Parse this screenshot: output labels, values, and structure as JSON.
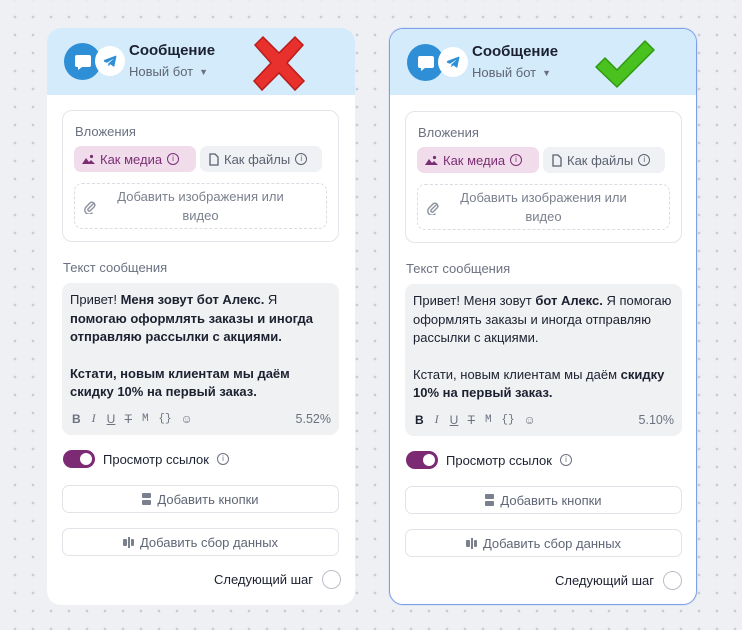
{
  "cards": [
    {
      "id": "left",
      "verdict": "cross",
      "header": {
        "title": "Сообщение",
        "subtitle": "Новый бот"
      },
      "attachments": {
        "label": "Вложения",
        "media_chip": "Как медиа",
        "files_chip": "Как файлы",
        "dropzone": "Добавить изображения или видео"
      },
      "message": {
        "label": "Текст сообщения",
        "segments": [
          {
            "text": "Привет! ",
            "bold": false
          },
          {
            "text": "Меня зовут бот Алекс.",
            "bold": true
          },
          {
            "text": " Я ",
            "bold": false
          },
          {
            "text": "помогаю оформлять заказы и иногда",
            "bold": true
          },
          {
            "text": " отправляю рассылки с акциями.",
            "bold": true,
            "break_after": true
          },
          {
            "text": "Кстати, новым клиентам мы даём скидку 10% на первый заказ.",
            "bold": true
          }
        ],
        "counter": "5.52%"
      },
      "link_preview_label": "Просмотр ссылок",
      "add_buttons_label": "Добавить кнопки",
      "add_data_collection_label": "Добавить сбор данных",
      "next_step_label": "Следующий шаг"
    },
    {
      "id": "right",
      "verdict": "check",
      "header": {
        "title": "Сообщение",
        "subtitle": "Новый бот"
      },
      "attachments": {
        "label": "Вложения",
        "media_chip": "Как медиа",
        "files_chip": "Как файлы",
        "dropzone": "Добавить изображения или видео"
      },
      "message": {
        "label": "Текст сообщения",
        "segments": [
          {
            "text": "Привет! Меня зовут ",
            "bold": false
          },
          {
            "text": "бот Алекс.",
            "bold": true
          },
          {
            "text": " Я помогаю оформлять заказы и иногда отправляю рассылки с акциями.",
            "bold": false,
            "break_after": true
          },
          {
            "text": "Кстати, новым клиентам мы даём ",
            "bold": false
          },
          {
            "text": "скидку 10% на первый заказ.",
            "bold": true
          }
        ],
        "counter": "5.10%"
      },
      "link_preview_label": "Просмотр ссылок",
      "add_buttons_label": "Добавить кнопки",
      "add_data_collection_label": "Добавить сбор данных",
      "next_step_label": "Следующий шаг"
    }
  ],
  "toolbar": {
    "bold": "B",
    "italic": "I",
    "underline": "U",
    "strike": "T",
    "mono": "M",
    "vars": "{}",
    "emoji": "☺"
  },
  "colors": {
    "header_bg": "#d3ebfa",
    "avatar_blue": "#2e8fd6",
    "accent_purple": "#7c2a73",
    "chip_media_bg": "#f1dcec",
    "cross_red": "#e8302c",
    "check_green": "#49c21f",
    "right_border": "#7f9fe8"
  },
  "icons": {
    "avatar": "chat-bubble-icon",
    "platform": "telegram-icon",
    "media": "image-icon",
    "files": "file-icon",
    "dropzone": "paperclip-icon",
    "info": "info-icon",
    "buttons": "buttons-icon",
    "collect": "data-collection-icon",
    "verdict_bad": "cross-icon",
    "verdict_good": "checkmark-icon"
  }
}
